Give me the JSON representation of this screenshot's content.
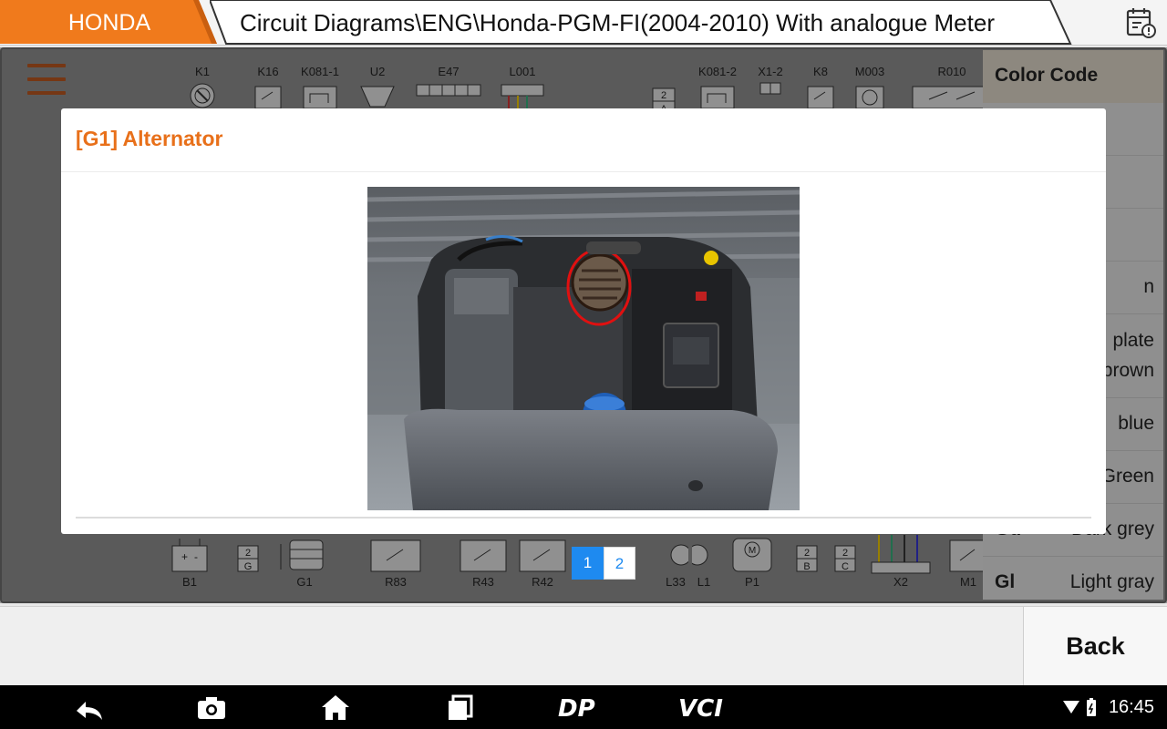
{
  "header": {
    "brand": "HONDA",
    "path": "Circuit Diagrams\\ENG\\Honda-PGM-FI(2004-2010) With analogue Meter",
    "report_icon": "calendar-alert-icon"
  },
  "diagram": {
    "top_components": [
      {
        "label": "K1"
      },
      {
        "label": "K16"
      },
      {
        "label": "K081-1"
      },
      {
        "label": "U2"
      },
      {
        "label": "E47"
      },
      {
        "label": "L001"
      },
      {
        "label": "K081-2"
      },
      {
        "label": "X1-2"
      },
      {
        "label": "K8"
      },
      {
        "label": "M003"
      },
      {
        "label": "R010"
      }
    ],
    "bottom_components": [
      {
        "label": "B1"
      },
      {
        "label": "G1"
      },
      {
        "label": "R83"
      },
      {
        "label": "R43"
      },
      {
        "label": "R42"
      },
      {
        "label": "L33"
      },
      {
        "label": "L1"
      },
      {
        "label": "P1"
      },
      {
        "label": "X2"
      },
      {
        "label": "M1"
      }
    ]
  },
  "color_code": {
    "title": "Color Code",
    "rows": [
      {
        "code": "",
        "name": ""
      },
      {
        "code": "",
        "name": ""
      },
      {
        "code": "",
        "name": ""
      },
      {
        "code": "",
        "name": "n"
      },
      {
        "code": "",
        "name": "plate brown"
      },
      {
        "code": "",
        "name": "blue"
      },
      {
        "code": "",
        "name": "Green"
      },
      {
        "code": "Gd",
        "name": "Dark grey"
      },
      {
        "code": "Gl",
        "name": "Light gray"
      }
    ]
  },
  "modal": {
    "title": "[G1] Alternator"
  },
  "pager": {
    "pages": [
      "1",
      "2"
    ],
    "current": "1"
  },
  "footer": {
    "back_label": "Back"
  },
  "system": {
    "time": "16:45"
  }
}
